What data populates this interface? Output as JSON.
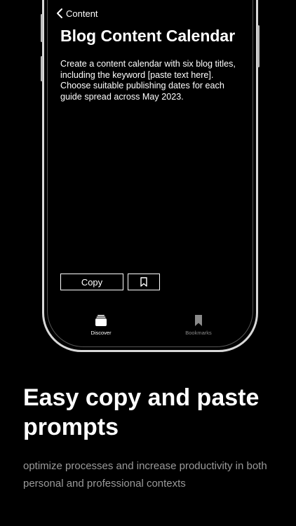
{
  "nav": {
    "back_label": "Content"
  },
  "prompt": {
    "title": "Blog Content Calendar",
    "body": "Create a content calendar with six blog titles, including the keyword [paste text here]. Choose suitable publishing dates for each guide spread across May 2023."
  },
  "actions": {
    "copy_label": "Copy",
    "bookmark_icon": "bookmark-icon"
  },
  "tab_bar": {
    "tabs": [
      {
        "label": "Discover",
        "icon": "stack-icon",
        "active": true
      },
      {
        "label": "Bookmarks",
        "icon": "bookmark-icon",
        "active": false
      }
    ]
  },
  "marketing": {
    "headline": "Easy copy and paste prompts",
    "subtext": "optimize processes and increase productivity in both personal and professional contexts"
  },
  "colors": {
    "background": "#000000",
    "frame": "#d8d8d8",
    "text_primary": "#ffffff",
    "text_secondary": "#9a9a9a",
    "tab_inactive": "#8a8a8a"
  }
}
